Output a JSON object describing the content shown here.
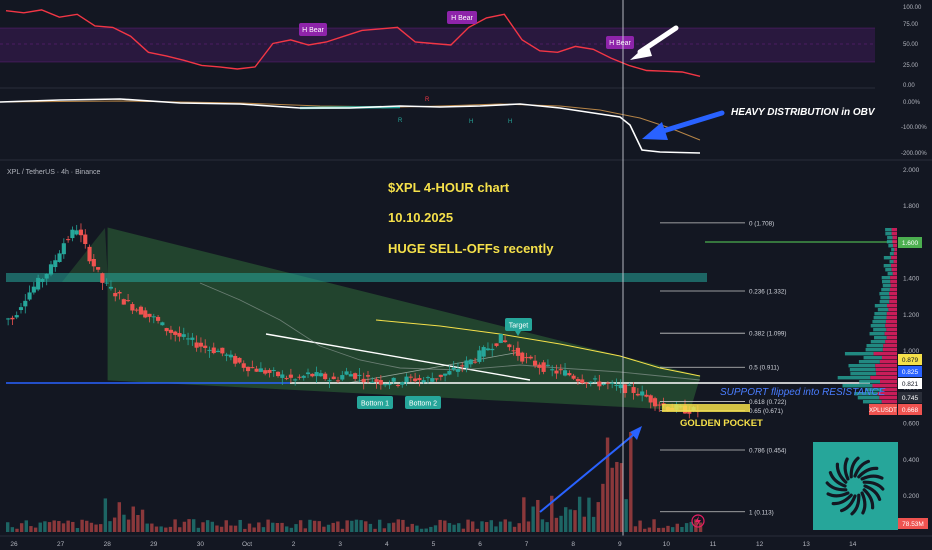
{
  "symbol_label": "XPL / TetherUS · 4h · Binance",
  "colors": {
    "bg": "#131722",
    "up": "#26a69a",
    "down": "#ef5350",
    "yellow": "#f5e04a",
    "rsi": "#f23645",
    "obv": "#ffffff",
    "fib": "#c8c8c8",
    "purple": "#8e24aa",
    "blue": "#2962ff",
    "support_text": "#4a7dff",
    "brand": "#26a69a"
  },
  "annotations": {
    "title_line1": "$XPL    4-HOUR chart",
    "title_line2": "10.10.2025",
    "title_line3": "HUGE SELL-OFFs recently",
    "obv_note": "HEAVY DISTRIBUTION in OBV",
    "support_note": "SUPPORT flipped into RESISTANCE",
    "golden_pocket": "GOLDEN POCKET",
    "target": "Target",
    "bottom1": "Bottom 1",
    "bottom2": "Bottom 2",
    "hbear": "H Bear",
    "div_r": "R",
    "div_h": "H"
  },
  "price_axis": {
    "ticks": [
      "2.000",
      "1.800",
      "1.600",
      "1.400",
      "1.200",
      "1.000",
      "0.800",
      "0.600",
      "0.400",
      "0.200"
    ]
  },
  "price_tags": {
    "green_level": "1.600",
    "t1": "0.879",
    "t2": "0.825",
    "t3": "0.821",
    "t4": "0.745",
    "last_label": "XPLUSDT",
    "last": "0.668",
    "vol": "78.53M"
  },
  "rsi_axis": {
    "ticks": [
      "100.00",
      "75.00",
      "50.00",
      "25.00",
      "0.00"
    ]
  },
  "obv_axis": {
    "ticks": [
      "0.00%",
      "-100.00%",
      "-200.00%"
    ]
  },
  "fib_levels": [
    {
      "label": "0 (1.708)",
      "price": 1.708
    },
    {
      "label": "0.236 (1.332)",
      "price": 1.332
    },
    {
      "label": "0.382 (1.099)",
      "price": 1.099
    },
    {
      "label": "0.5 (0.911)",
      "price": 0.911
    },
    {
      "label": "0.618 (0.722)",
      "price": 0.722
    },
    {
      "label": "0.65 (0.671)",
      "price": 0.671
    },
    {
      "label": "0.786 (0.454)",
      "price": 0.454
    },
    {
      "label": "1 (0.113)",
      "price": 0.113
    }
  ],
  "x_axis": {
    "labels": [
      "26",
      "27",
      "28",
      "29",
      "30",
      "Oct",
      "2",
      "3",
      "4",
      "5",
      "6",
      "7",
      "8",
      "9",
      "10",
      "11",
      "12",
      "13",
      "14"
    ]
  },
  "chart_data": {
    "type": "candlestick",
    "timeframe": "4h",
    "x_labels": [
      "26",
      "27",
      "28",
      "29",
      "30",
      "Oct",
      "2",
      "3",
      "4",
      "5",
      "6",
      "7",
      "8",
      "9",
      "10",
      "11",
      "12",
      "13",
      "14"
    ],
    "y_axis": {
      "min": 0.0,
      "max": 2.0,
      "label": ""
    },
    "approx_close_path": [
      1.18,
      1.3,
      1.38,
      1.46,
      1.6,
      1.68,
      1.52,
      1.38,
      1.32,
      1.26,
      1.22,
      1.18,
      1.12,
      1.08,
      1.05,
      1.02,
      1.0,
      0.96,
      0.92,
      0.9,
      0.88,
      0.86,
      0.84,
      0.87,
      0.86,
      0.84,
      0.88,
      0.86,
      0.84,
      0.83,
      0.83,
      0.85,
      0.84,
      0.86,
      0.88,
      0.92,
      0.96,
      1.02,
      1.07,
      1.0,
      0.95,
      0.92,
      0.89,
      0.88,
      0.85,
      0.83,
      0.82,
      0.8,
      0.79,
      0.76,
      0.72,
      0.69,
      0.68,
      0.67,
      0.668
    ],
    "last_price": 0.668,
    "support_resistance": [
      0.821
    ],
    "resistance_zone": [
      1.37,
      1.42
    ],
    "rsi_approx": [
      95,
      92,
      96,
      86,
      90,
      74,
      72,
      60,
      38,
      33,
      27,
      20,
      18,
      15,
      18,
      50,
      55,
      48,
      52,
      60,
      68,
      70,
      72,
      52,
      50,
      48,
      72,
      85,
      90,
      55,
      40,
      38,
      46,
      42,
      30,
      20,
      13,
      12,
      11,
      5
    ]
  }
}
